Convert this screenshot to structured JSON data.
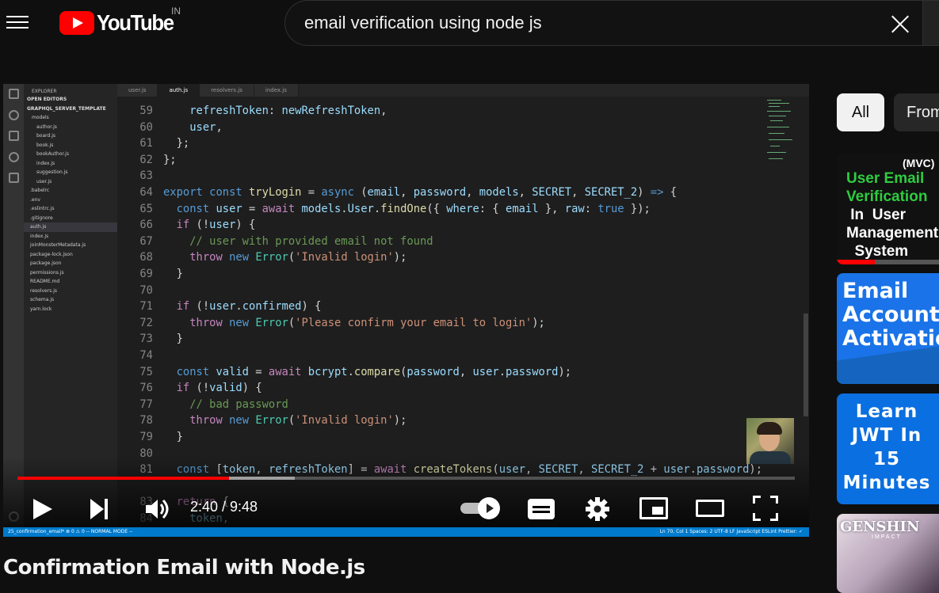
{
  "header": {
    "logo_text": "YouTube",
    "country": "IN",
    "search_value": "email verification using node js"
  },
  "player": {
    "current_time": "2:40",
    "duration": "9:48",
    "time_display": "2:40 / 9:48",
    "progress_fraction": 0.272,
    "buffered_fraction": 0.357
  },
  "editor": {
    "explorer_title": "EXPLORER",
    "sections": [
      "OPEN EDITORS",
      "GRAPHQL_SERVER_TEMPLATE"
    ],
    "files": [
      "models",
      "author.js",
      "board.js",
      "book.js",
      "bookAuthor.js",
      "index.js",
      "suggestion.js",
      "user.js",
      ".babelrc",
      ".env",
      ".eslintrc.js",
      ".gitignore",
      "auth.js",
      "index.js",
      "joinMonsterMetadata.js",
      "package-lock.json",
      "package.json",
      "permissions.js",
      "README.md",
      "resolvers.js",
      "schema.js",
      "yarn.lock"
    ],
    "tabs": [
      "user.js",
      "auth.js",
      "resolvers.js",
      "index.js"
    ],
    "active_tab": "auth.js",
    "status_left": "25_confirmation_email*   ⊗ 0 ⚠ 0   -- NORMAL MODE --",
    "status_right": "Ln 70, Col 1   Spaces: 2   UTF-8   LF   JavaScript   ESLint   Prettier: ✓"
  },
  "video": {
    "title": "Confirmation Email with Node.js"
  },
  "chips": [
    "All",
    "From"
  ],
  "recommendations": [
    {
      "line_a": "(MVC)",
      "line_b": "User Email",
      "line_c": "Verification",
      "line_d": " In  User",
      "line_e": "Management",
      "line_f": "  System",
      "watched_fraction": 0.34
    },
    {
      "line_a": "Email",
      "line_b": "Account",
      "line_c": "Activation"
    },
    {
      "line_a": "Learn",
      "line_b": "JWT In",
      "line_c": "15",
      "line_d": "Minutes"
    },
    {
      "line_a": "GENSHIN",
      "line_b": "IMPACT"
    }
  ],
  "colors": {
    "youtube_red": "#ff0000",
    "background": "#0f0f0f",
    "editor_bg": "#1e1e1e",
    "statusbar": "#007acc"
  }
}
